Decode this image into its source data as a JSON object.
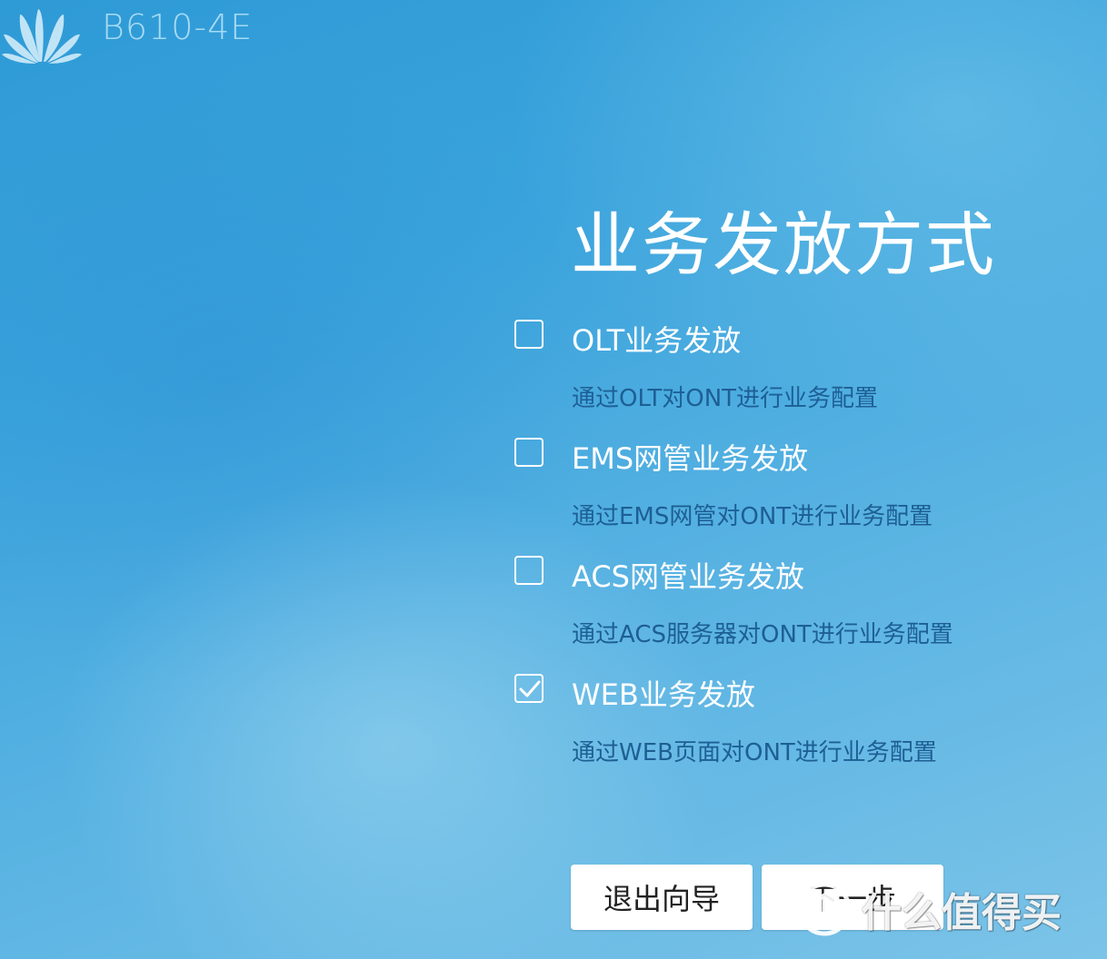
{
  "header": {
    "model_name": "B610-4E"
  },
  "page_title": "业务发放方式",
  "options": [
    {
      "label": "OLT业务发放",
      "description": "通过OLT对ONT进行业务配置",
      "checked": false
    },
    {
      "label": "EMS网管业务发放",
      "description": "通过EMS网管对ONT进行业务配置",
      "checked": false
    },
    {
      "label": "ACS网管业务发放",
      "description": "通过ACS服务器对ONT进行业务配置",
      "checked": false
    },
    {
      "label": "WEB业务发放",
      "description": "通过WEB页面对ONT进行业务配置",
      "checked": true
    }
  ],
  "buttons": {
    "exit_label": "退出向导",
    "next_label": "下一步"
  },
  "watermark": {
    "text": "什么值得买"
  },
  "colors": {
    "background": "#3aa3dc",
    "title": "#ffffff",
    "description": "#1d5f94",
    "button_bg": "#ffffff"
  }
}
